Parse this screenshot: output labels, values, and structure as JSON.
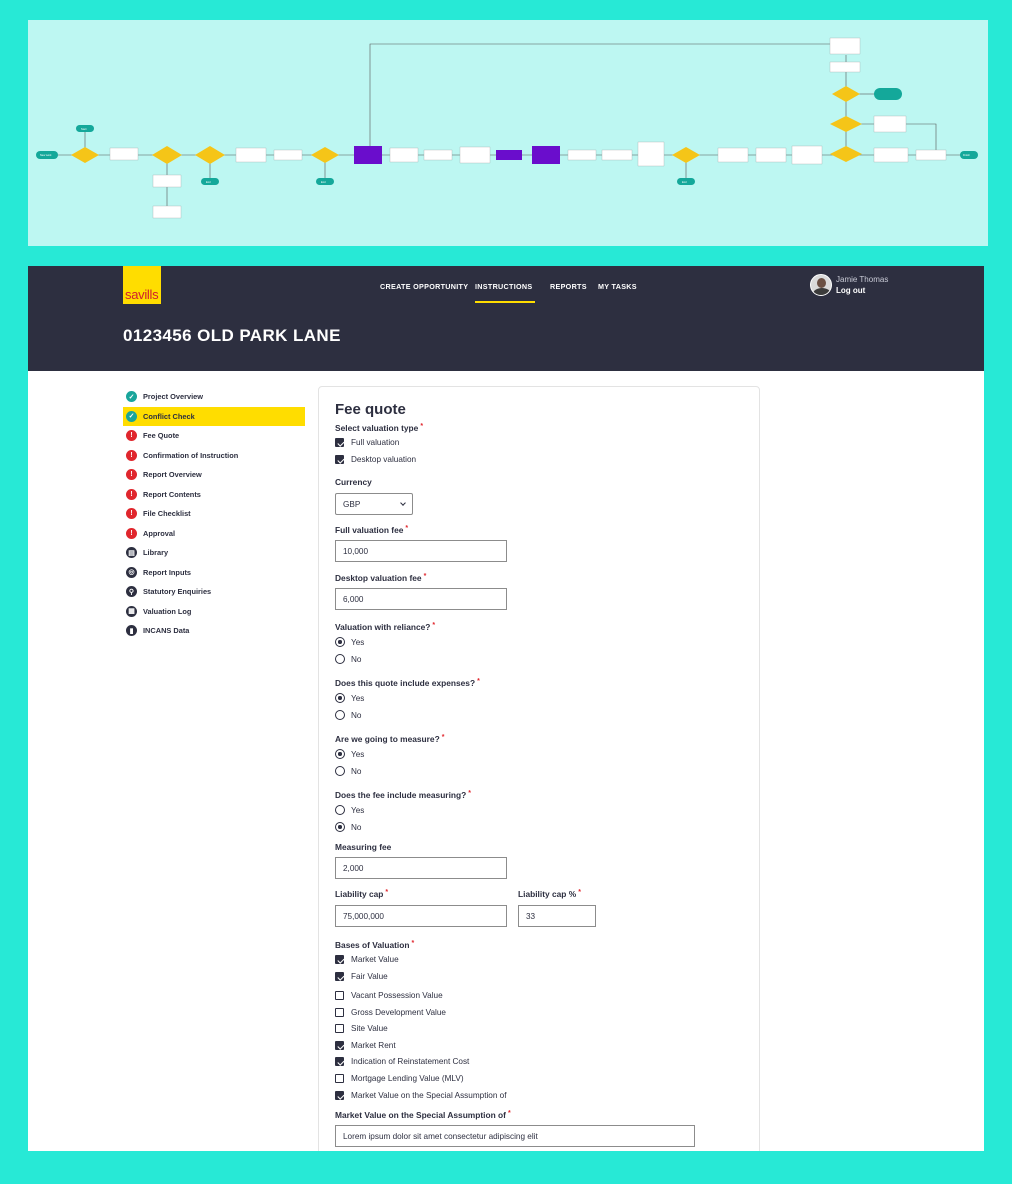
{
  "flowchart": {
    "caption": "",
    "nodes": [
      {
        "id": "n1",
        "text": "Start",
        "kind": "terminal"
      },
      {
        "id": "n2",
        "text": "New work",
        "kind": "terminal"
      },
      {
        "id": "n3",
        "text": "",
        "kind": "decision"
      },
      {
        "id": "n4",
        "text": "",
        "kind": "process"
      },
      {
        "id": "n5",
        "text": "",
        "kind": "decision"
      },
      {
        "id": "n6",
        "text": "",
        "kind": "decision"
      },
      {
        "id": "n7",
        "text": "End",
        "kind": "terminal"
      },
      {
        "id": "n8",
        "text": "",
        "kind": "process"
      },
      {
        "id": "n9",
        "text": "",
        "kind": "process"
      },
      {
        "id": "n10",
        "text": "",
        "kind": "decision"
      },
      {
        "id": "n11",
        "text": "End",
        "kind": "terminal"
      },
      {
        "id": "n12",
        "text": "",
        "kind": "highlight"
      },
      {
        "id": "n13",
        "text": "",
        "kind": "process"
      },
      {
        "id": "n14",
        "text": "",
        "kind": "process"
      },
      {
        "id": "n15",
        "text": "",
        "kind": "process"
      },
      {
        "id": "n16",
        "text": "",
        "kind": "highlight"
      },
      {
        "id": "n17",
        "text": "",
        "kind": "highlight"
      },
      {
        "id": "n18",
        "text": "",
        "kind": "process"
      },
      {
        "id": "n19",
        "text": "",
        "kind": "process"
      },
      {
        "id": "n20",
        "text": "",
        "kind": "process"
      },
      {
        "id": "n21",
        "text": "",
        "kind": "decision"
      },
      {
        "id": "n22",
        "text": "End",
        "kind": "terminal"
      },
      {
        "id": "n23",
        "text": "",
        "kind": "process"
      },
      {
        "id": "n24",
        "text": "",
        "kind": "process"
      },
      {
        "id": "n25",
        "text": "",
        "kind": "process"
      },
      {
        "id": "n26",
        "text": "",
        "kind": "decision"
      },
      {
        "id": "n27",
        "text": "",
        "kind": "process"
      },
      {
        "id": "n28",
        "text": "",
        "kind": "process"
      },
      {
        "id": "n29",
        "text": "Finish",
        "kind": "terminal"
      },
      {
        "id": "n30",
        "text": "",
        "kind": "process"
      },
      {
        "id": "n31",
        "text": "",
        "kind": "process"
      },
      {
        "id": "n32",
        "text": "",
        "kind": "decision"
      },
      {
        "id": "n33",
        "text": "",
        "kind": "terminal"
      },
      {
        "id": "n34",
        "text": "",
        "kind": "decision"
      },
      {
        "id": "n35",
        "text": "",
        "kind": "process"
      },
      {
        "id": "n36",
        "text": "",
        "kind": "process"
      },
      {
        "id": "n37",
        "text": "",
        "kind": "process"
      }
    ]
  },
  "brand": {
    "logo_text": "savills",
    "logo_bg": "#ffdd00",
    "logo_text_color": "#d0202e"
  },
  "nav": {
    "items": [
      "CREATE OPPORTUNITY",
      "INSTRUCTIONS",
      "REPORTS",
      "MY TASKS"
    ],
    "active": "INSTRUCTIONS"
  },
  "user": {
    "name": "Jamie Thomas",
    "logout": "Log out"
  },
  "page": {
    "title": "0123456 OLD PARK LANE"
  },
  "sidebar": {
    "items": [
      {
        "label": "Project Overview",
        "icon": "check-circle-icon",
        "status": "complete"
      },
      {
        "label": "Conflict Check",
        "icon": "check-circle-icon",
        "status": "complete",
        "active": true
      },
      {
        "label": "Fee Quote",
        "icon": "alert-circle-icon",
        "status": "incomplete"
      },
      {
        "label": "Confirmation of Instruction",
        "icon": "alert-circle-icon",
        "status": "incomplete"
      },
      {
        "label": "Report Overview",
        "icon": "alert-circle-icon",
        "status": "incomplete"
      },
      {
        "label": "Report Contents",
        "icon": "alert-circle-icon",
        "status": "incomplete"
      },
      {
        "label": "File Checklist",
        "icon": "alert-circle-icon",
        "status": "incomplete"
      },
      {
        "label": "Approval",
        "icon": "alert-circle-icon",
        "status": "incomplete"
      },
      {
        "label": "Library",
        "icon": "book-icon",
        "status": "neutral"
      },
      {
        "label": "Report Inputs",
        "icon": "search-circle-icon",
        "status": "neutral"
      },
      {
        "label": "Statutory Enquiries",
        "icon": "magnifier-icon",
        "status": "neutral"
      },
      {
        "label": "Valuation Log",
        "icon": "grid-icon",
        "status": "neutral"
      },
      {
        "label": "INCANS Data",
        "icon": "bar-chart-icon",
        "status": "neutral"
      }
    ]
  },
  "form": {
    "title": "Fee quote",
    "valuation_type": {
      "label": "Select valuation type",
      "options": [
        {
          "label": "Full valuation",
          "checked": true
        },
        {
          "label": "Desktop valuation",
          "checked": true
        }
      ]
    },
    "currency": {
      "label": "Currency",
      "value": "GBP"
    },
    "full_fee": {
      "label": "Full valuation fee",
      "value": "10,000"
    },
    "desktop_fee": {
      "label": "Desktop valuation fee",
      "value": "6,000"
    },
    "reliance": {
      "label": "Valuation with reliance?",
      "options": [
        "Yes",
        "No"
      ],
      "selected": "Yes"
    },
    "expenses": {
      "label": "Does this quote include expenses?",
      "options": [
        "Yes",
        "No"
      ],
      "selected": "Yes"
    },
    "measure": {
      "label": "Are we going to measure?",
      "options": [
        "Yes",
        "No"
      ],
      "selected": "Yes"
    },
    "fee_measuring": {
      "label": "Does the fee include measuring?",
      "options": [
        "Yes",
        "No"
      ],
      "selected": "No"
    },
    "measuring_fee": {
      "label": "Measuring fee",
      "value": "2,000"
    },
    "liability_cap": {
      "label": "Liability cap",
      "value": "75,000,000"
    },
    "liability_cap_pct": {
      "label": "Liability cap %",
      "value": "33"
    },
    "bases": {
      "label": "Bases of Valuation",
      "options": [
        {
          "label": "Market Value",
          "checked": true
        },
        {
          "label": "Fair Value",
          "checked": true
        },
        {
          "label": "Vacant Possession Value",
          "checked": false
        },
        {
          "label": "Gross Development Value",
          "checked": false
        },
        {
          "label": "Site Value",
          "checked": false
        },
        {
          "label": "Market Rent",
          "checked": true
        },
        {
          "label": "Indication of Reinstatement Cost",
          "checked": true
        },
        {
          "label": "Mortgage Lending Value (MLV)",
          "checked": false
        },
        {
          "label": "Market Value on the Special Assumption of",
          "checked": true
        }
      ]
    },
    "special_assumption": {
      "label": "Market Value on the Special Assumption of",
      "value": "Lorem ipsum dolor sit amet consectetur adipiscing elit"
    }
  },
  "colors": {
    "page_bg": "#27e9d6",
    "flow_bg": "#bdf7f2",
    "nav_bg": "#2d2f40",
    "accent": "#ffdd00",
    "complete": "#19a59b",
    "alert": "#e0262d",
    "purple": "#6a0dcc",
    "decision": "#f5c518",
    "terminal": "#14a89a"
  }
}
